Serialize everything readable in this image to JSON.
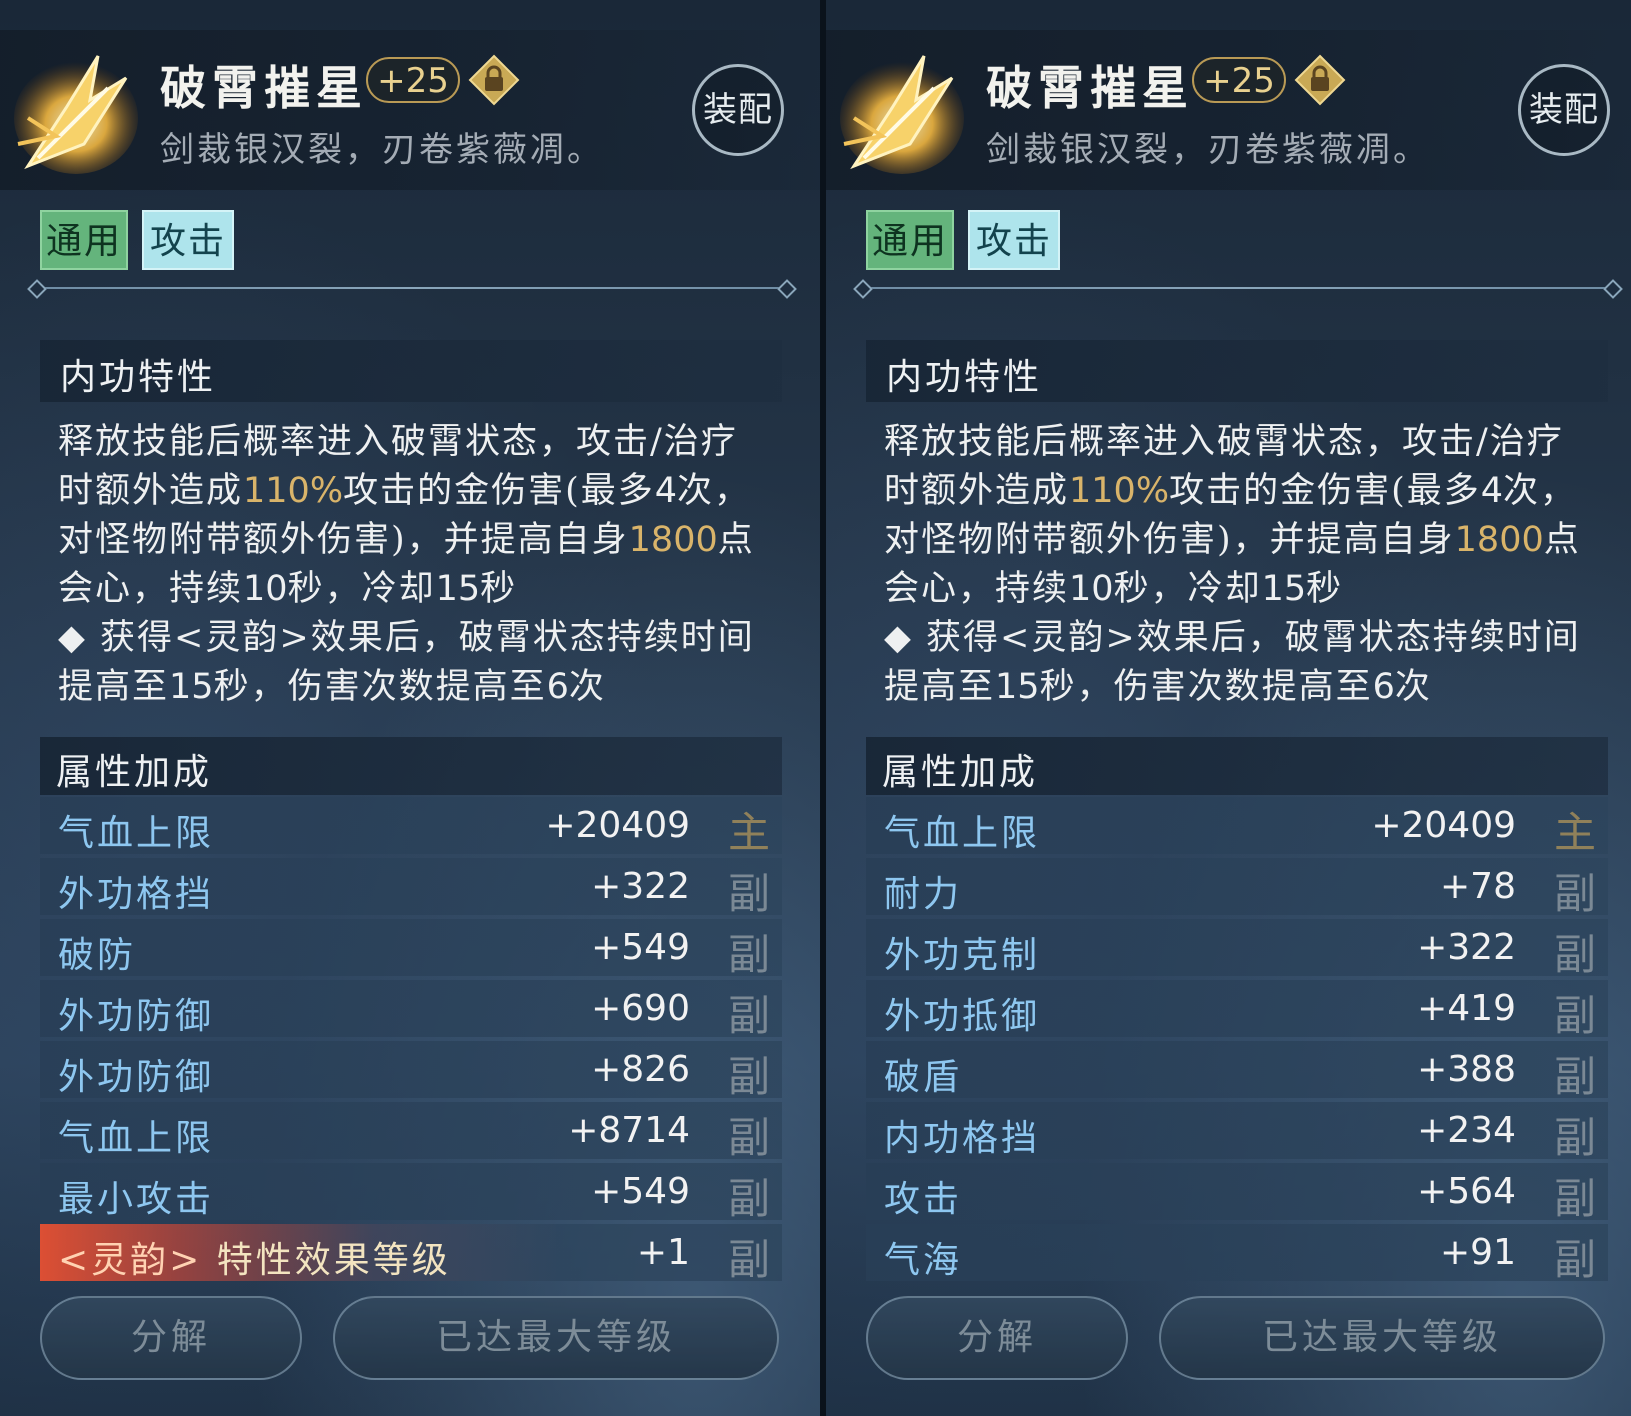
{
  "colors": {
    "accent_gold": "#d9b46a",
    "attr_blue": "#8ec7f0",
    "tag_green": "#64b47c",
    "tag_cyan": "#aee4ec"
  },
  "left": {
    "title": "破霄摧星",
    "plus": "+25",
    "subtitle": "剑裁银汉裂，刃卷紫薇凋。",
    "equip": "装配",
    "tags": [
      "通用",
      "攻击"
    ],
    "trait_header": "内功特性",
    "desc": {
      "p1": "释放技能后概率进入破霄状态，攻击/治疗时额外造成",
      "pct": "110%",
      "p2": "攻击的金伤害(最多",
      "n4": "4",
      "p3": "次，对怪物附带额外伤害)，并提高自身",
      "crit": "1800",
      "p4": "点会心，持续",
      "n10": "10",
      "p5": "秒，冷却",
      "n15": "15",
      "p6": "秒",
      "p7": "◆ 获得<灵韵>效果后，破霄状态持续时间提高至",
      "n15b": "15",
      "p8": "秒，伤害次数提高至",
      "n6": "6",
      "p9": "次"
    },
    "attr_header": "属性加成",
    "attrs": [
      {
        "name": "气血上限",
        "value": "+20409",
        "tag": "主"
      },
      {
        "name": "外功格挡",
        "value": "+322",
        "tag": "副"
      },
      {
        "name": "破防",
        "value": "+549",
        "tag": "副"
      },
      {
        "name": "外功防御",
        "value": "+690",
        "tag": "副"
      },
      {
        "name": "外功防御",
        "value": "+826",
        "tag": "副"
      },
      {
        "name": "气血上限",
        "value": "+8714",
        "tag": "副"
      },
      {
        "name": "最小攻击",
        "value": "+549",
        "tag": "副"
      },
      {
        "name_prefix": "<灵韵>",
        "name": "特性效果等级",
        "value": "+1",
        "tag": "副"
      }
    ],
    "btn_decompose": "分解",
    "btn_max": "已达最大等级"
  },
  "right": {
    "title": "破霄摧星",
    "plus": "+25",
    "subtitle": "剑裁银汉裂，刃卷紫薇凋。",
    "equip": "装配",
    "tags": [
      "通用",
      "攻击"
    ],
    "trait_header": "内功特性",
    "desc": {
      "p1": "释放技能后概率进入破霄状态，攻击/治疗时额外造成",
      "pct": "110%",
      "p2": "攻击的金伤害(最多",
      "n4": "4",
      "p3": "次，对怪物附带额外伤害)，并提高自身",
      "crit": "1800",
      "p4": "点会心，持续",
      "n10": "10",
      "p5": "秒，冷却",
      "n15": "15",
      "p6": "秒",
      "p7": "◆ 获得<灵韵>效果后，破霄状态持续时间提高至",
      "n15b": "15",
      "p8": "秒，伤害次数提高至",
      "n6": "6",
      "p9": "次"
    },
    "attr_header": "属性加成",
    "attrs": [
      {
        "name": "气血上限",
        "value": "+20409",
        "tag": "主"
      },
      {
        "name": "耐力",
        "value": "+78",
        "tag": "副"
      },
      {
        "name": "外功克制",
        "value": "+322",
        "tag": "副"
      },
      {
        "name": "外功抵御",
        "value": "+419",
        "tag": "副"
      },
      {
        "name": "破盾",
        "value": "+388",
        "tag": "副"
      },
      {
        "name": "内功格挡",
        "value": "+234",
        "tag": "副"
      },
      {
        "name": "攻击",
        "value": "+564",
        "tag": "副"
      },
      {
        "name": "气海",
        "value": "+91",
        "tag": "副"
      }
    ],
    "btn_decompose": "分解",
    "btn_max": "已达最大等级"
  }
}
